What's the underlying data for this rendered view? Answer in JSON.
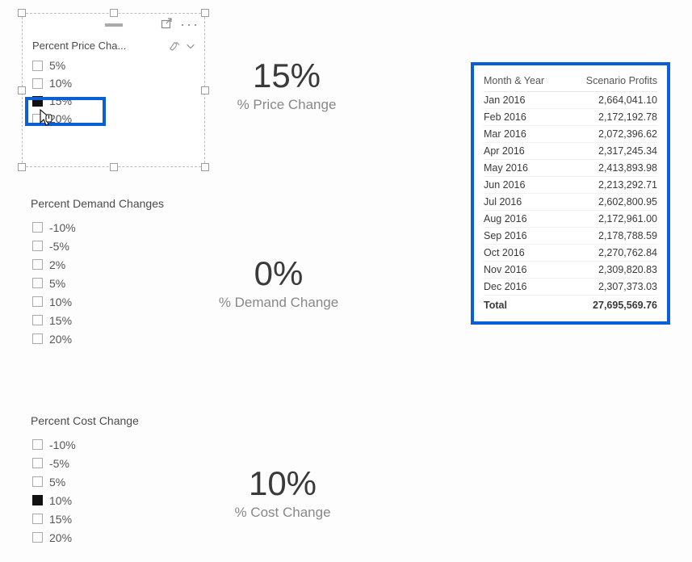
{
  "price_slicer": {
    "title": "Percent Price Cha...",
    "options": [
      "5%",
      "10%",
      "15%",
      "20%"
    ],
    "selected": "15%"
  },
  "price_card": {
    "value": "15%",
    "label": "% Price Change"
  },
  "demand_slicer": {
    "title": "Percent Demand Changes",
    "options": [
      "-10%",
      "-5%",
      "2%",
      "5%",
      "10%",
      "15%",
      "20%"
    ],
    "selected": null
  },
  "demand_card": {
    "value": "0%",
    "label": "% Demand Change"
  },
  "cost_slicer": {
    "title": "Percent Cost Change",
    "options": [
      "-10%",
      "-5%",
      "5%",
      "10%",
      "15%",
      "20%"
    ],
    "selected": "10%"
  },
  "cost_card": {
    "value": "10%",
    "label": "% Cost Change"
  },
  "table": {
    "columns": [
      "Month & Year",
      "Scenario Profits"
    ],
    "rows": [
      [
        "Jan 2016",
        "2,664,041.10"
      ],
      [
        "Feb 2016",
        "2,172,192.78"
      ],
      [
        "Mar 2016",
        "2,072,396.62"
      ],
      [
        "Apr 2016",
        "2,317,245.34"
      ],
      [
        "May 2016",
        "2,413,893.98"
      ],
      [
        "Jun 2016",
        "2,213,292.71"
      ],
      [
        "Jul 2016",
        "2,602,800.95"
      ],
      [
        "Aug 2016",
        "2,172,961.00"
      ],
      [
        "Sep 2016",
        "2,178,788.59"
      ],
      [
        "Oct 2016",
        "2,270,762.84"
      ],
      [
        "Nov 2016",
        "2,309,820.83"
      ],
      [
        "Dec 2016",
        "2,307,373.03"
      ]
    ],
    "total": [
      "Total",
      "27,695,569.76"
    ]
  }
}
